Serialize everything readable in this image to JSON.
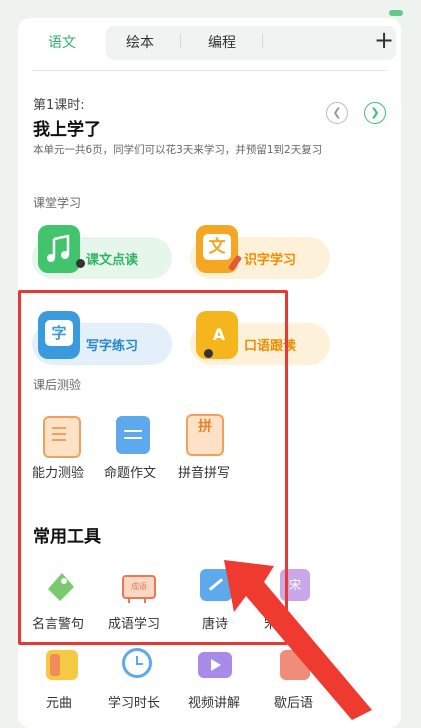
{
  "tabs": {
    "items": [
      {
        "label": "语文"
      },
      {
        "label": "绘本"
      },
      {
        "label": "编程"
      }
    ],
    "add_label": "+"
  },
  "lesson": {
    "number": "第1课时:",
    "title": "我上学了",
    "description": "本单元一共6页，同学们可以花3天来学习，并预留1到2天复习",
    "prev_icon": "chevron-left-icon",
    "next_icon": "chevron-right-icon"
  },
  "classroom": {
    "heading": "课堂学习",
    "items": [
      {
        "label": "课文点读",
        "color": "#42c46c"
      },
      {
        "label": "识字学习",
        "color": "#f5a623"
      },
      {
        "label": "写字练习",
        "color": "#3a9bdc"
      },
      {
        "label": "口语跟读",
        "color": "#f5a623"
      }
    ]
  },
  "quiz": {
    "heading": "课后测验",
    "items": [
      {
        "label": "能力测验",
        "icon": "notebook-icon"
      },
      {
        "label": "命题作文",
        "icon": "document-icon"
      },
      {
        "label": "拼音拼写",
        "icon": "pinyin-book-icon"
      }
    ],
    "pinyin_glyph": "拼"
  },
  "tools": {
    "heading": "常用工具",
    "items": [
      {
        "label": "名言警句",
        "icon": "quote-tag-icon"
      },
      {
        "label": "成语学习",
        "icon": "idiom-easel-icon",
        "badge": "成语"
      },
      {
        "label": "唐诗",
        "icon": "poem-scroll-icon"
      },
      {
        "label": "宋词",
        "icon": "ci-poem-icon",
        "badge": "宋"
      },
      {
        "label": "元曲",
        "icon": "yuanqu-icon"
      },
      {
        "label": "学习时长",
        "icon": "clock-icon"
      },
      {
        "label": "视频讲解",
        "icon": "video-icon"
      },
      {
        "label": "歇后语",
        "icon": "riddle-icon"
      }
    ]
  },
  "icons": {
    "text_char": "文",
    "write_char": "字",
    "oral_char": "A"
  }
}
